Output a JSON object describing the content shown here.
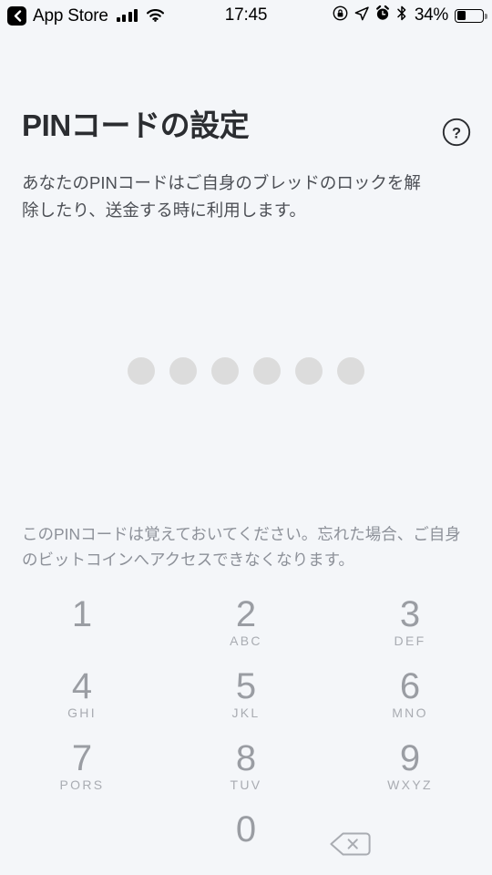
{
  "statusbar": {
    "back_label": "App Store",
    "back_icon": "chevron-left-icon",
    "signal_icon": "cellular-signal-icon",
    "wifi_icon": "wifi-icon",
    "time": "17:45",
    "rotation_lock_icon": "rotation-lock-icon",
    "location_icon": "location-arrow-icon",
    "alarm_icon": "alarm-clock-icon",
    "bluetooth_icon": "bluetooth-icon",
    "battery_percent": "34%",
    "battery_level": 34,
    "battery_icon": "battery-icon"
  },
  "header": {
    "title": "PINコードの設定",
    "help_icon": "question-mark-circle-icon"
  },
  "content": {
    "description": "あなたのPINコードはご自身のブレッドのロックを解除したり、送金する時に利用します。",
    "note": "このPINコードは覚えておいてください。忘れた場合、ご自身のビットコインへアクセスできなくなります。",
    "pin": {
      "length": 6,
      "entered": 0,
      "empty_color": "#DCDCDC",
      "filled_color": "#8D9199"
    }
  },
  "keypad": {
    "keys": [
      {
        "digit": "1",
        "letters": "",
        "name": "key-1"
      },
      {
        "digit": "2",
        "letters": "ABC",
        "name": "key-2"
      },
      {
        "digit": "3",
        "letters": "DEF",
        "name": "key-3"
      },
      {
        "digit": "4",
        "letters": "GHI",
        "name": "key-4"
      },
      {
        "digit": "5",
        "letters": "JKL",
        "name": "key-5"
      },
      {
        "digit": "6",
        "letters": "MNO",
        "name": "key-6"
      },
      {
        "digit": "7",
        "letters": "PORS",
        "name": "key-7"
      },
      {
        "digit": "8",
        "letters": "TUV",
        "name": "key-8"
      },
      {
        "digit": "9",
        "letters": "WXYZ",
        "name": "key-9"
      },
      {
        "digit": "",
        "letters": "",
        "name": "key-blank"
      },
      {
        "digit": "0",
        "letters": "",
        "name": "key-0"
      },
      {
        "digit": "",
        "letters": "",
        "name": "key-delete",
        "icon": "backspace-icon"
      }
    ]
  },
  "colors": {
    "background": "#F4F6F9",
    "title": "#2B2D31",
    "body_text": "#4C4F55",
    "muted_text": "#8D9199",
    "keypad_digit": "#9A9DA3"
  }
}
